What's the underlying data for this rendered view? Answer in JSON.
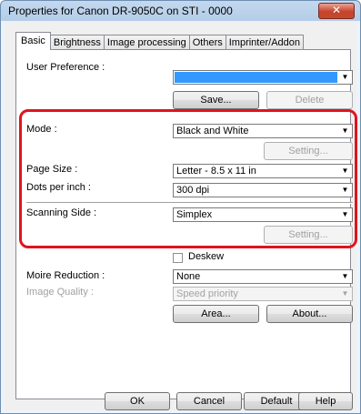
{
  "window": {
    "title": "Properties for Canon DR-9050C on STI - 0000",
    "close_glyph": "✕"
  },
  "tabs": [
    {
      "label": "Basic"
    },
    {
      "label": "Brightness"
    },
    {
      "label": "Image processing"
    },
    {
      "label": "Others"
    },
    {
      "label": "Imprinter/Addon"
    }
  ],
  "user_preference": {
    "label": "User Preference :",
    "value": "",
    "save_label": "Save...",
    "delete_label": "Delete"
  },
  "mode": {
    "label": "Mode :",
    "value": "Black and White",
    "setting_label": "Setting..."
  },
  "page_size": {
    "label": "Page Size :",
    "value": "Letter - 8.5 x 11 in"
  },
  "dpi": {
    "label": "Dots per inch :",
    "value": "300 dpi"
  },
  "scanning_side": {
    "label": "Scanning Side :",
    "value": "Simplex",
    "setting_label": "Setting..."
  },
  "deskew": {
    "label": "Deskew",
    "checked": false
  },
  "moire": {
    "label": "Moire Reduction :",
    "value": "None"
  },
  "image_quality": {
    "label": "Image Quality :",
    "value": "Speed priority"
  },
  "area_label": "Area...",
  "about_label": "About...",
  "footer": {
    "ok_label": "OK",
    "cancel_label": "Cancel",
    "default_label": "Default",
    "help_label": "Help"
  },
  "icons": {
    "dropdown_arrow": "▼"
  },
  "colors": {
    "highlight_box": "#e0141e",
    "selection": "#3399ff"
  }
}
